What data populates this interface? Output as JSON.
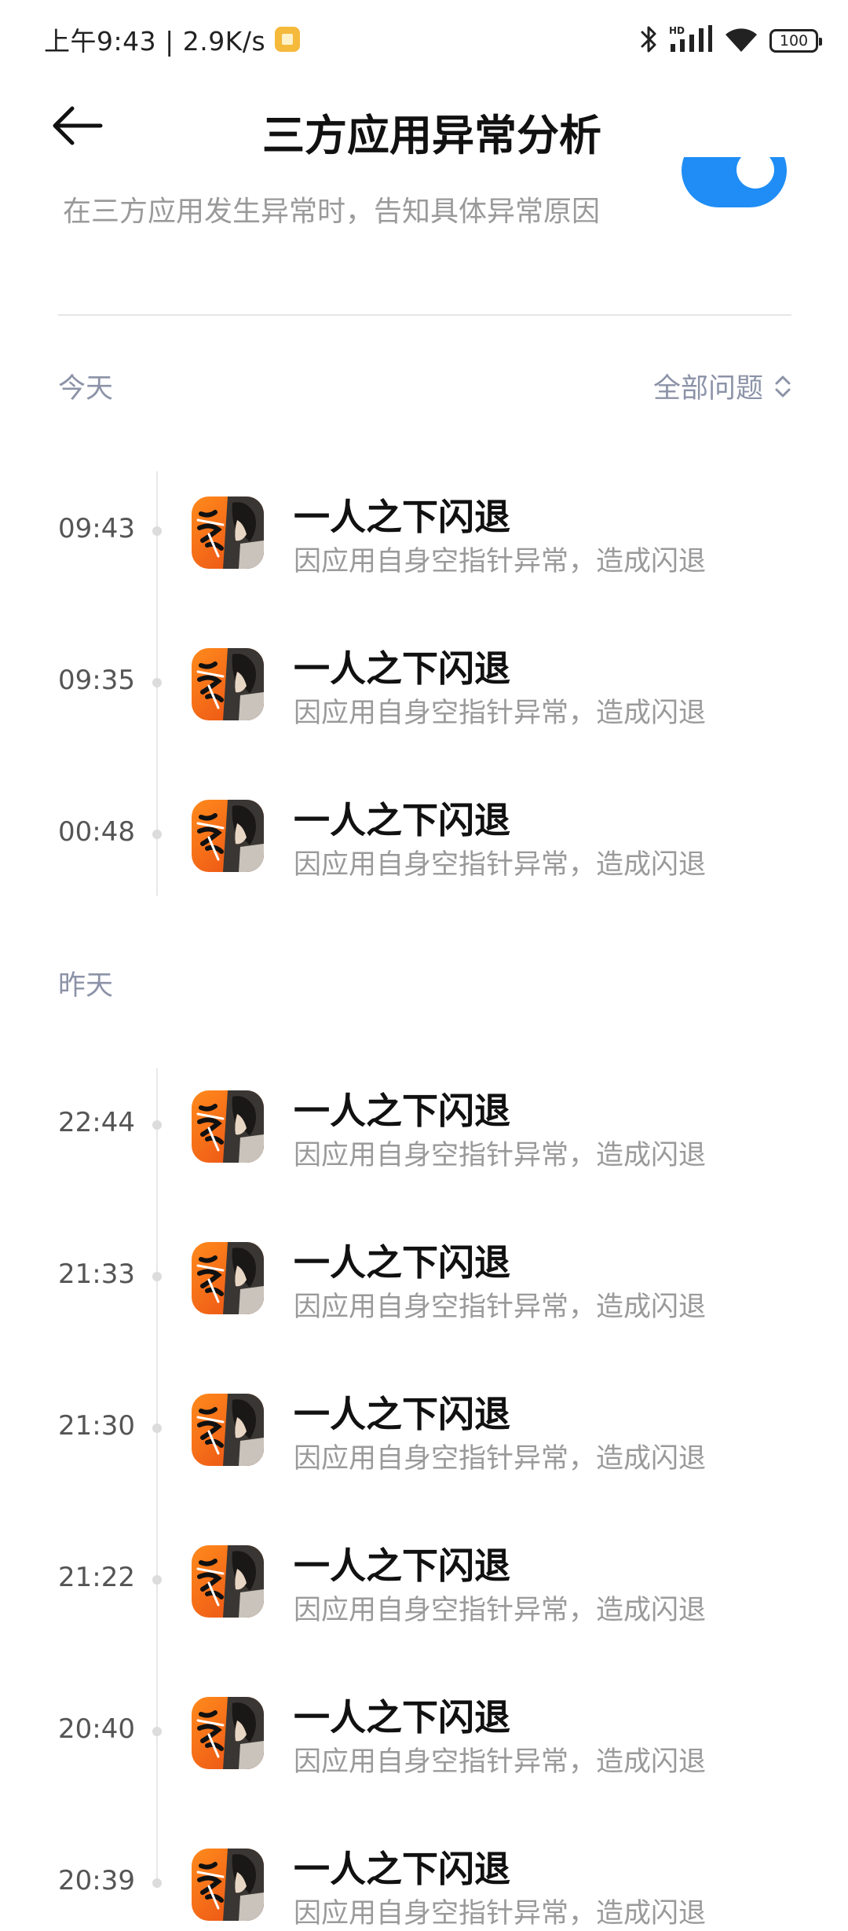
{
  "status_bar": {
    "time_speed": "上午9:43 | 2.9K/s",
    "battery": "100",
    "icons": [
      "notification-app-icon",
      "bluetooth-icon",
      "hd-signal-icon",
      "wifi-icon",
      "battery-icon"
    ]
  },
  "header": {
    "title": "三方应用异常分析",
    "back_icon": "arrow-left-icon"
  },
  "toggle_row": {
    "description": "在三方应用发生异常时，告知具体异常原因",
    "enabled": true
  },
  "colors": {
    "accent": "#1f8df5",
    "section_label": "#8c93a8",
    "subtitle": "#9a9a9a"
  },
  "sections": [
    {
      "label": "今天",
      "filter_label": "全部问题",
      "filter_icon": "sort-chevrons-icon",
      "entries": [
        {
          "time": "09:43",
          "title": "一人之下闪退",
          "desc": "因应用自身空指针异常，造成闪退"
        },
        {
          "time": "09:35",
          "title": "一人之下闪退",
          "desc": "因应用自身空指针异常，造成闪退"
        },
        {
          "time": "00:48",
          "title": "一人之下闪退",
          "desc": "因应用自身空指针异常，造成闪退"
        }
      ]
    },
    {
      "label": "昨天",
      "entries": [
        {
          "time": "22:44",
          "title": "一人之下闪退",
          "desc": "因应用自身空指针异常，造成闪退"
        },
        {
          "time": "21:33",
          "title": "一人之下闪退",
          "desc": "因应用自身空指针异常，造成闪退"
        },
        {
          "time": "21:30",
          "title": "一人之下闪退",
          "desc": "因应用自身空指针异常，造成闪退"
        },
        {
          "time": "21:22",
          "title": "一人之下闪退",
          "desc": "因应用自身空指针异常，造成闪退"
        },
        {
          "time": "20:40",
          "title": "一人之下闪退",
          "desc": "因应用自身空指针异常，造成闪退"
        },
        {
          "time": "20:39",
          "title": "一人之下闪退",
          "desc": "因应用自身空指针异常，造成闪退"
        }
      ]
    }
  ]
}
